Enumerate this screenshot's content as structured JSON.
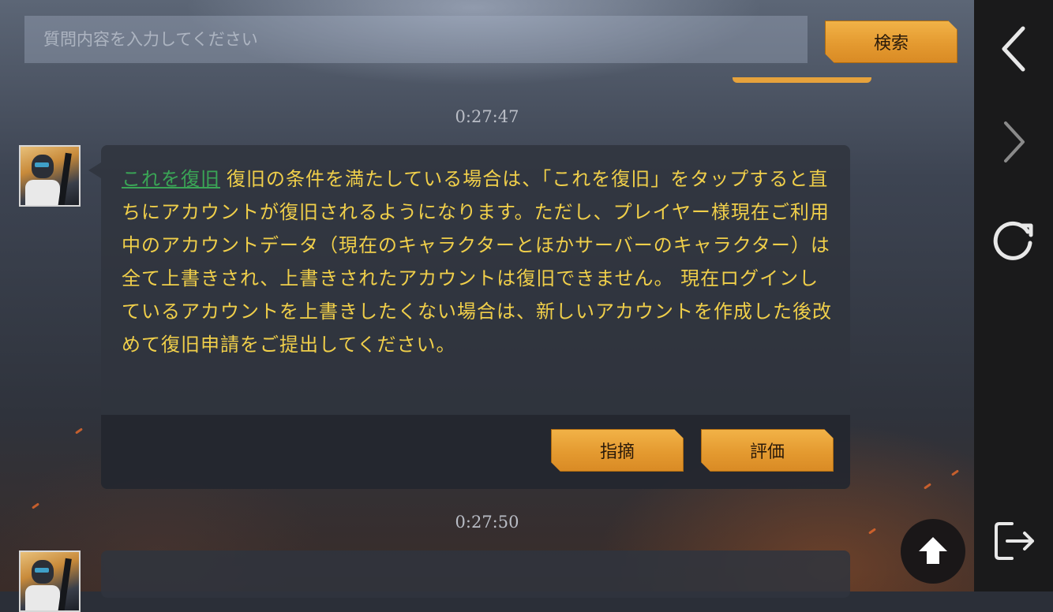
{
  "search": {
    "placeholder": "質問内容を入力してください",
    "button_label": "検索"
  },
  "messages": [
    {
      "timestamp": "0:27:47",
      "link_text": "これを復旧",
      "text": "復旧の条件を満たしている場合は、「これを復旧」をタップすると直ちにアカウントが復旧されるようになります。ただし、プレイヤー様現在ご利用中のアカウントデータ（現在のキャラクターとほかサーバーのキャラクター）は全て上書きされ、上書きされたアカウントは復旧できません。 現在ログインしているアカウントを上書きしたくない場合は、新しいアカウントを作成した後改めて復旧申請をご提出してください。",
      "report_label": "指摘",
      "rate_label": "評価"
    },
    {
      "timestamp": "0:27:50"
    }
  ],
  "sidebar": {
    "icons": [
      "chevron-left-icon",
      "chevron-right-icon",
      "refresh-icon",
      "exit-icon"
    ]
  },
  "colors": {
    "accent_gold": "#e49a30",
    "message_text": "#f0cf4a",
    "link_green": "#3aa556",
    "sidebar_bg": "#1a1a1b"
  }
}
